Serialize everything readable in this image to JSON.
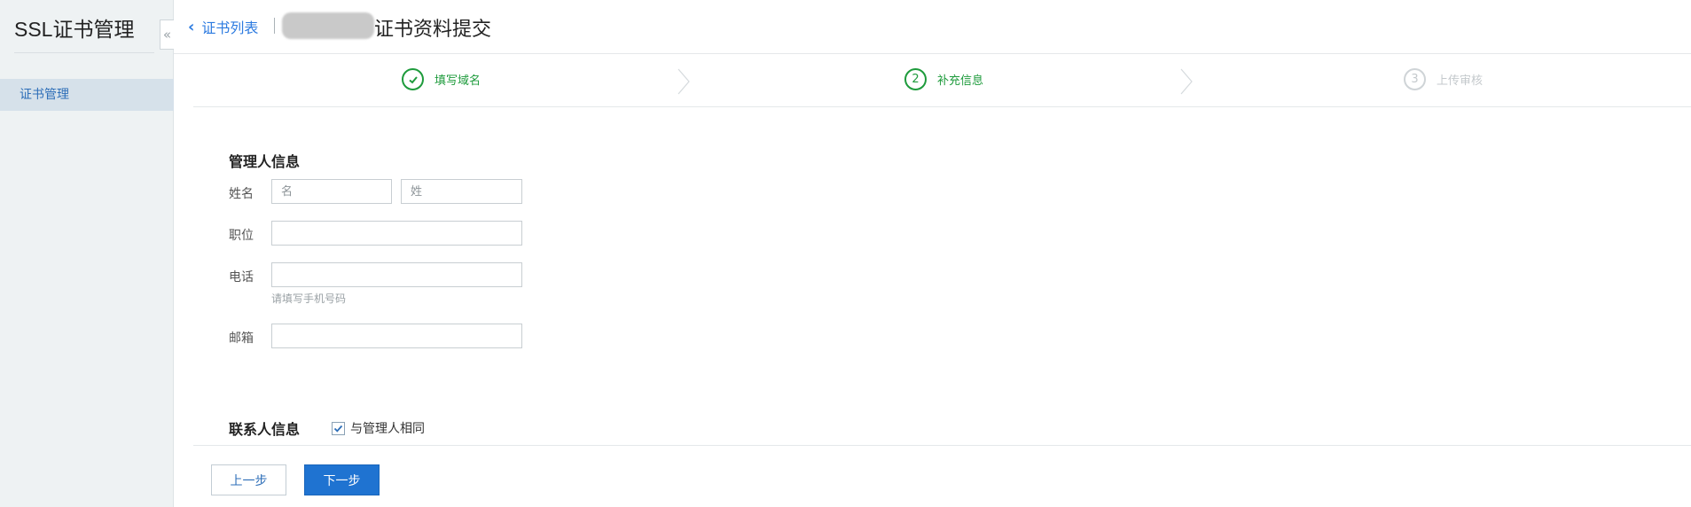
{
  "sidebar": {
    "title": "SSL证书管理",
    "items": [
      {
        "label": "证书管理"
      }
    ],
    "collapse_icon": "double-chevron-left-icon"
  },
  "header": {
    "back_label": "证书列表",
    "title": "证书资料提交"
  },
  "steps": [
    {
      "number": "1",
      "label": "填写域名",
      "status": "done"
    },
    {
      "number": "2",
      "label": "补充信息",
      "status": "active"
    },
    {
      "number": "3",
      "label": "上传审核",
      "status": "pending"
    }
  ],
  "form": {
    "admin_section_title": "管理人信息",
    "name_label": "姓名",
    "first_name_placeholder": "名",
    "last_name_placeholder": "姓",
    "position_label": "职位",
    "phone_label": "电话",
    "phone_hint": "请填写手机号码",
    "email_label": "邮箱",
    "contact_section_title": "联系人信息",
    "same_as_admin_label": "与管理人相同",
    "same_as_admin_checked": true
  },
  "buttons": {
    "prev": "上一步",
    "next": "下一步"
  },
  "colors": {
    "accent": "#2d7be0",
    "success": "#1e9b3c",
    "primary_button": "#1f73d1",
    "sidebar_bg": "#eef2f3"
  }
}
